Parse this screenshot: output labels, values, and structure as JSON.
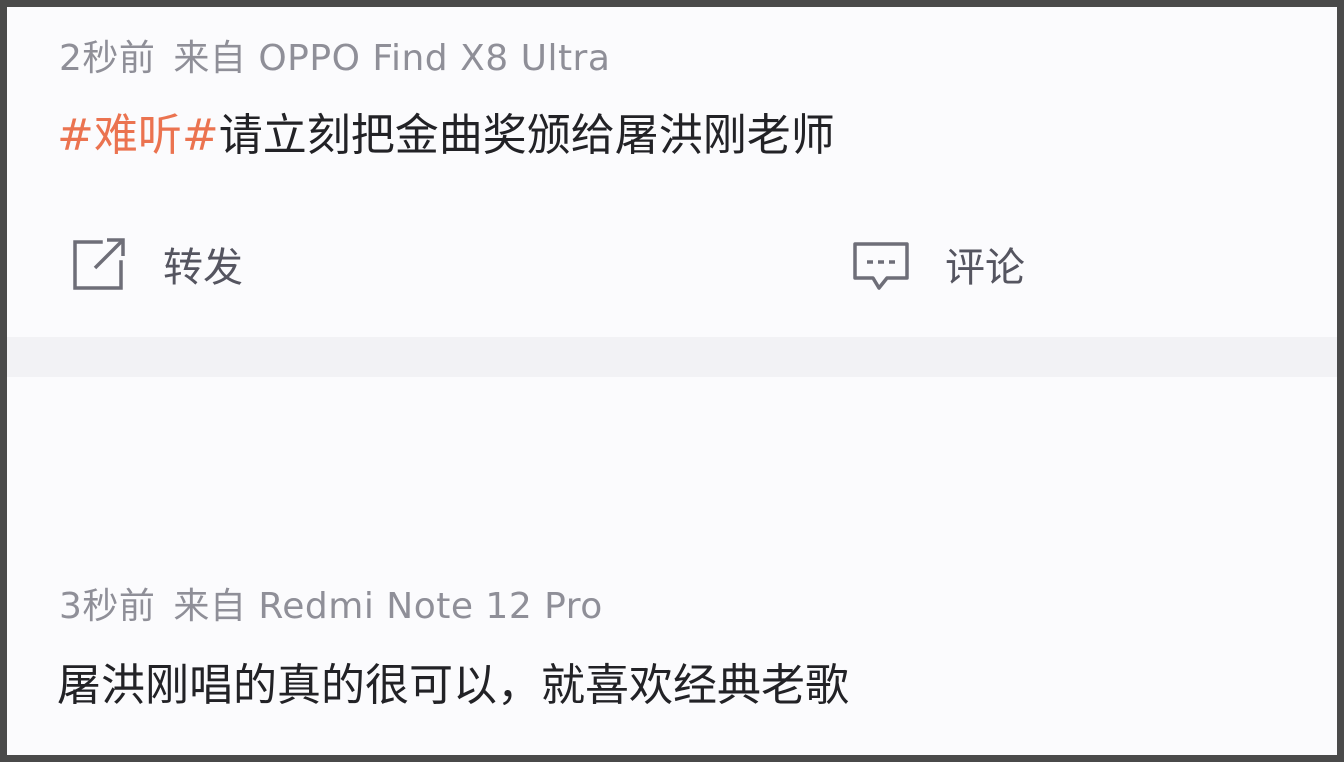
{
  "posts": [
    {
      "time": "2秒前",
      "source": "来自 OPPO Find X8 Ultra",
      "hashtag": "#难听#",
      "text": "请立刻把金曲奖颁给屠洪刚老师",
      "actions": {
        "repost": {
          "label": "转发",
          "icon": "repost-icon"
        },
        "comment": {
          "label": "评论",
          "icon": "comment-icon"
        }
      }
    },
    {
      "time": "3秒前",
      "source": "来自 Redmi Note 12 Pro",
      "text": "屠洪刚唱的真的很可以，就喜欢经典老歌"
    }
  ],
  "colors": {
    "hashtag": "#eb7350",
    "meta_text": "#8f8f98",
    "body_text": "#222226",
    "background": "#fbfbfd",
    "separator": "#f2f2f5"
  }
}
